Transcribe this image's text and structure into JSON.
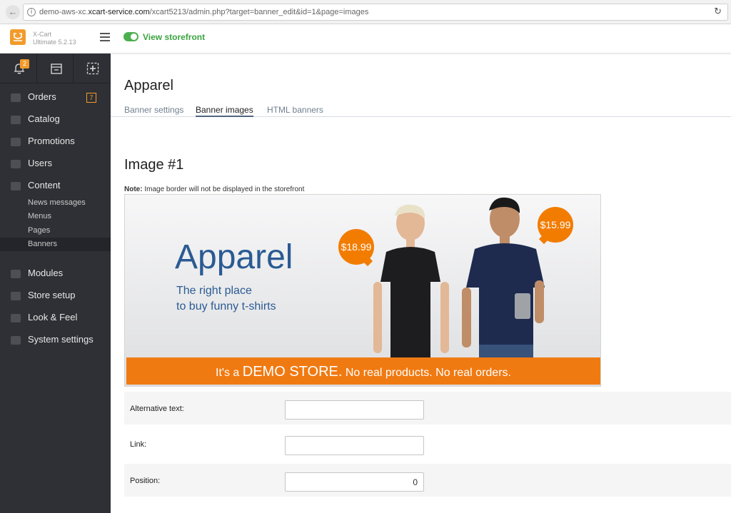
{
  "browser": {
    "url_prefix": "demo-aws-xc.",
    "url_domain": "xcart-service.com",
    "url_path": "/xcart5213/admin.php?target=banner_edit&id=1&page=images"
  },
  "header": {
    "brand_name": "X-Cart",
    "brand_version": "Ultimate 5.2.13",
    "view_storefront": "View storefront"
  },
  "sidebar": {
    "notification_count": "2",
    "items": [
      {
        "label": "Orders",
        "count": "7"
      },
      {
        "label": "Catalog"
      },
      {
        "label": "Promotions"
      },
      {
        "label": "Users"
      },
      {
        "label": "Content"
      },
      {
        "label": "Modules"
      },
      {
        "label": "Store setup"
      },
      {
        "label": "Look & Feel"
      },
      {
        "label": "System settings"
      }
    ],
    "content_sub": [
      "News messages",
      "Menus",
      "Pages",
      "Banners"
    ]
  },
  "main": {
    "title": "Apparel",
    "tabs": [
      "Banner settings",
      "Banner images",
      "HTML banners"
    ],
    "active_tab": "Banner images",
    "image_title": "Image #1",
    "note_label": "Note:",
    "note_text": "Image border will not be displayed in the storefront"
  },
  "banner": {
    "headline": "Apparel",
    "line1": "The right place",
    "line2": "to buy funny t-shirts",
    "price1": "$18.99",
    "price2": "$15.99",
    "strip_a": "It's a",
    "strip_b": "DEMO STORE.",
    "strip_c": "No real products. No real orders."
  },
  "form": {
    "alt_label": "Alternative text:",
    "alt_value": "",
    "link_label": "Link:",
    "link_value": "",
    "position_label": "Position:",
    "position_value": "0"
  },
  "colors": {
    "accent": "#f29b2b",
    "sidebar": "#2f3035",
    "storefront_green": "#3aa43f",
    "banner_blue": "#2a5b93",
    "banner_orange": "#f07a12"
  }
}
